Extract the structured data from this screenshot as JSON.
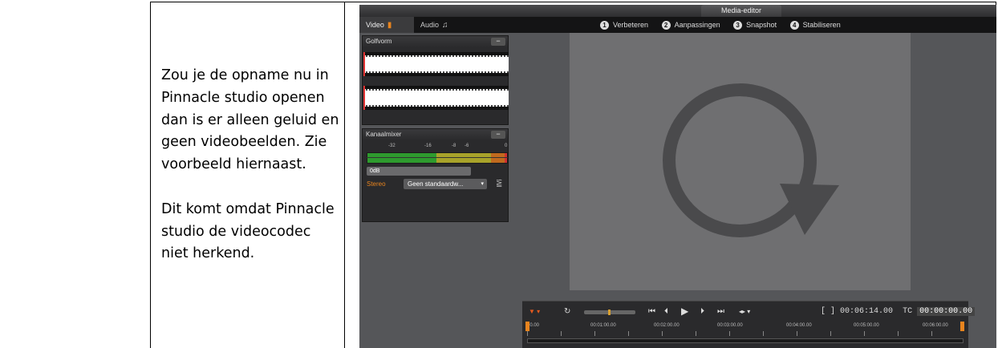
{
  "document": {
    "paragraph_1": "Zou je de opname nu in Pinnacle studio openen dan is er alleen geluid en geen videobeelden. Zie voorbeeld hiernaast.",
    "paragraph_2": "Dit komt omdat Pinnacle studio de videocodec niet herkend."
  },
  "media_editor": {
    "window_title": "Media-editor",
    "tabs": [
      {
        "label": "Video",
        "icon": "video-camera-icon"
      },
      {
        "label": "Audio",
        "icon": "music-note-icon"
      }
    ],
    "steps": [
      {
        "num": "1",
        "label": "Verbeteren"
      },
      {
        "num": "2",
        "label": "Aanpassingen"
      },
      {
        "num": "3",
        "label": "Snapshot"
      },
      {
        "num": "4",
        "label": "Stabiliseren"
      }
    ],
    "waveform_panel": {
      "title": "Golfvorm",
      "collapse": "−"
    },
    "mixer_panel": {
      "title": "Kanaalmixer",
      "collapse": "−",
      "scale": [
        "-32",
        "-16",
        "-8",
        "-6",
        "0"
      ],
      "level": "0dB",
      "mode": "Stereo",
      "preset": "Geen standaardw...",
      "preset_arrow": "▾",
      "eq_icon": "⪠"
    },
    "transport": {
      "marker": "▼ ▾",
      "loop": "↻",
      "buttons": [
        "⏮",
        "⏴",
        "▶",
        "⏵",
        "⏭",
        "◂▸ ▾"
      ],
      "duration_prefix": "[ ]",
      "duration": "00:06:14.00",
      "tc_label": "TC",
      "timecode": "00:00:00.00"
    },
    "ruler_labels": [
      "00.00",
      "00:01:00.00",
      "00:02:00.00",
      "00:03:00.00",
      "00:04:00.00",
      "00:05:00.00",
      "00:06:00.00"
    ],
    "colors": {
      "accent": "#e8841e",
      "panel": "#2a2a2c",
      "background": "#555659",
      "preview": "#6f6f71",
      "refresh_icon": "#4a4a4c"
    }
  }
}
